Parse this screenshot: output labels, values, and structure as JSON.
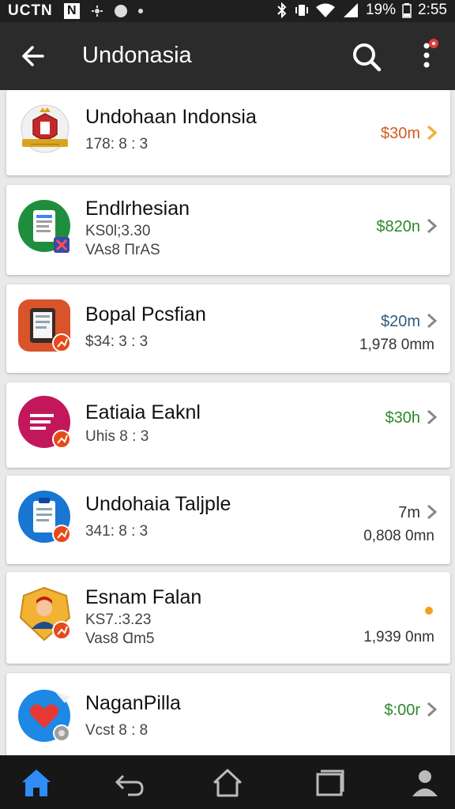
{
  "status_bar": {
    "carrier": "UCTN",
    "n_badge": "N",
    "battery": "19%",
    "time": "2:55"
  },
  "app_bar": {
    "title": "Undonasia"
  },
  "items": [
    {
      "title": "Undohaan Indonsia",
      "line1": "178: 8 : 3",
      "price": "$30m",
      "price_color": "#d45a1f",
      "chevron_color": "#f0b13a"
    },
    {
      "title": "Endlrhesian",
      "line1": "KS0l;3.30",
      "line2": "VAs8 ΠrAS",
      "price": "$820n",
      "price_color": "#2a8a2a"
    },
    {
      "title": "Bopal Pcsfian",
      "line1": "$34: 3 : 3",
      "price": "$20m",
      "price_color": "#2c5c7f",
      "note": "1,978 0mm"
    },
    {
      "title": "Eatiaia Eaknl",
      "line1": "Uhis 8 : 3",
      "price": "$30h",
      "price_color": "#2a8a2a"
    },
    {
      "title": "Undohaia Taljple",
      "line1": "341: 8 : 3",
      "price": "7m",
      "price_color": "#333333",
      "note": "0,808 0mn"
    },
    {
      "title": "Esnam Falan",
      "line1": "KS7.:3.23",
      "line2": "Vas8 Ɑm5",
      "note": "1,939 0nm"
    },
    {
      "title": "NaganPilla",
      "line1": "Vcst 8 : 8",
      "price": "$:00r",
      "price_color": "#2a8a2a"
    }
  ],
  "icons": {
    "back": "arrow-left-icon",
    "search": "search-icon",
    "more": "more-vert-icon",
    "nav": [
      "home-icon",
      "back-nav-icon",
      "house-icon",
      "recents-icon",
      "profile-icon"
    ]
  }
}
